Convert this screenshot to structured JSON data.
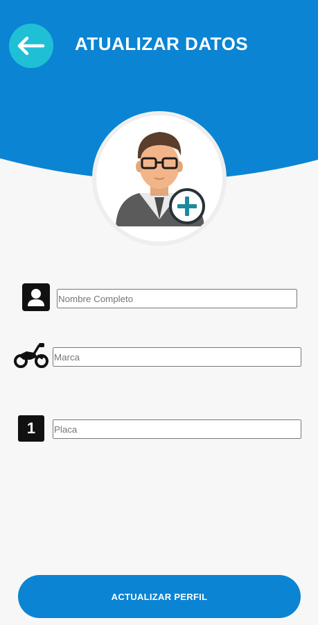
{
  "header": {
    "title": "ATUALIZAR DATOS",
    "back_icon": "arrow-left-icon",
    "color": "#0b84d3"
  },
  "avatar": {
    "icon": "user-avatar-icon",
    "add_icon": "plus-circle-icon"
  },
  "form": {
    "full_name": {
      "placeholder": "Nombre Completo",
      "value": "",
      "icon": "person-card-icon"
    },
    "brand": {
      "placeholder": "Marca",
      "value": "",
      "icon": "motorcycle-icon"
    },
    "plate": {
      "placeholder": "Placa",
      "value": "",
      "icon": "number-one-icon",
      "icon_text": "1"
    }
  },
  "submit": {
    "label": "ACTUALIZAR PERFIL",
    "color": "#0b84d3"
  }
}
